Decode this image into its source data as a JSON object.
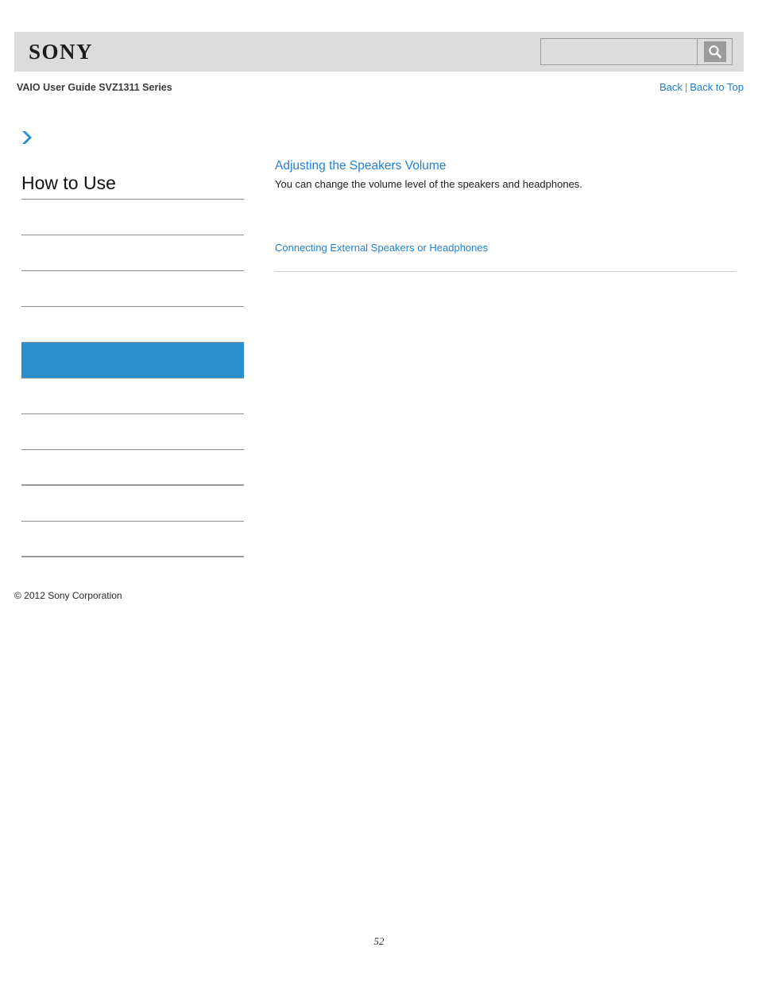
{
  "header": {
    "logo_text": "SONY",
    "logo_alt": "sony-logo",
    "search": {
      "value": "",
      "placeholder": "",
      "button_icon": "search-icon"
    },
    "guide_title": "VAIO User Guide SVZ1311 Series",
    "nav": {
      "back_label": "Back",
      "separator": "|",
      "back_to_top_label": "Back to Top"
    }
  },
  "sidebar": {
    "arrow_icon": "chevron-right-icon",
    "title": "How to Use",
    "items": [
      {
        "label": "",
        "selected": false,
        "thick_rule": false
      },
      {
        "label": "",
        "selected": false,
        "thick_rule": false
      },
      {
        "label": "",
        "selected": false,
        "thick_rule": false
      },
      {
        "label": "",
        "selected": false,
        "thick_rule": false
      },
      {
        "label": "",
        "selected": true,
        "thick_rule": false
      },
      {
        "label": "",
        "selected": false,
        "thick_rule": false
      },
      {
        "label": "",
        "selected": false,
        "thick_rule": false
      },
      {
        "label": "",
        "selected": false,
        "thick_rule": true
      },
      {
        "label": "",
        "selected": false,
        "thick_rule": false
      },
      {
        "label": "",
        "selected": false,
        "thick_rule": true
      }
    ]
  },
  "main": {
    "title": "Adjusting the Speakers Volume",
    "description": "You can change the volume level of the speakers and headphones.",
    "related_link": "Connecting External Speakers or Headphones"
  },
  "footer": {
    "copyright": "© 2012 Sony Corporation",
    "page_number": "52"
  },
  "colors": {
    "accent_blue": "#2b8fcd",
    "link_blue": "#2481d1",
    "header_gray": "#dcdcdc",
    "rule_gray": "#8d8d8d"
  }
}
